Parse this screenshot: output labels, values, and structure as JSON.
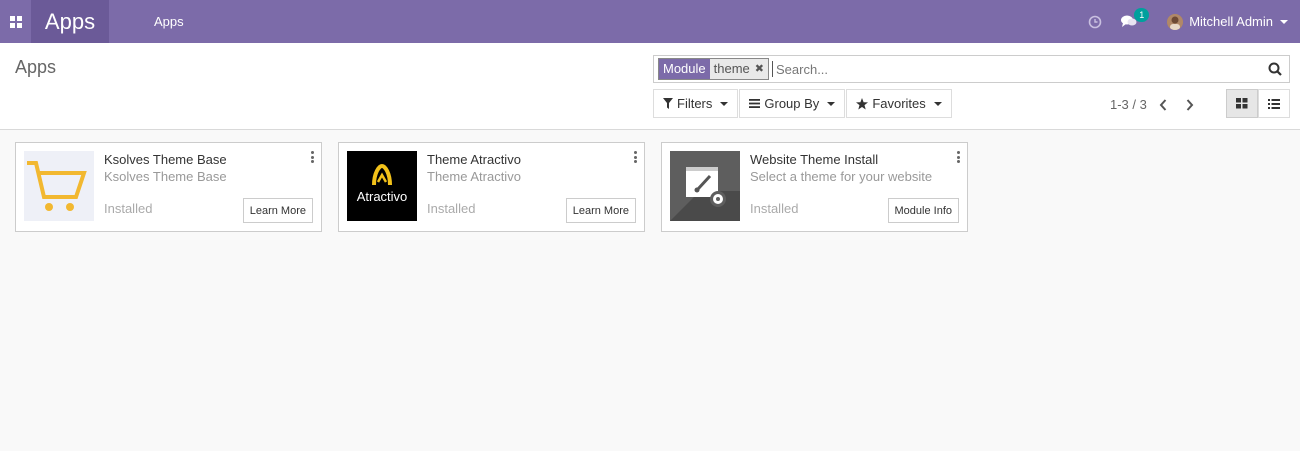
{
  "navbar": {
    "brand": "Apps",
    "menu_item": "Apps",
    "chat_count": "1",
    "user_name": "Mitchell Admin",
    "color": "#7c6ba9"
  },
  "control_panel": {
    "breadcrumb": "Apps",
    "search": {
      "facet_label": "Module",
      "facet_value": "theme",
      "placeholder": "Search..."
    },
    "filters_label": "Filters",
    "groupby_label": "Group By",
    "favorites_label": "Favorites",
    "pager": "1-3 / 3"
  },
  "cards": [
    {
      "title": "Ksolves Theme Base",
      "subtitle": "Ksolves Theme Base",
      "status": "Installed",
      "button": "Learn More",
      "icon": "cart-icon"
    },
    {
      "title": "Theme Atractivo",
      "subtitle": "Theme Atractivo",
      "status": "Installed",
      "button": "Learn More",
      "icon": "atractivo-logo",
      "logo_text": "Atractivo"
    },
    {
      "title": "Website Theme Install",
      "subtitle": "Select a theme for your website",
      "status": "Installed",
      "button": "Module Info",
      "icon": "paintbrush-icon"
    }
  ]
}
